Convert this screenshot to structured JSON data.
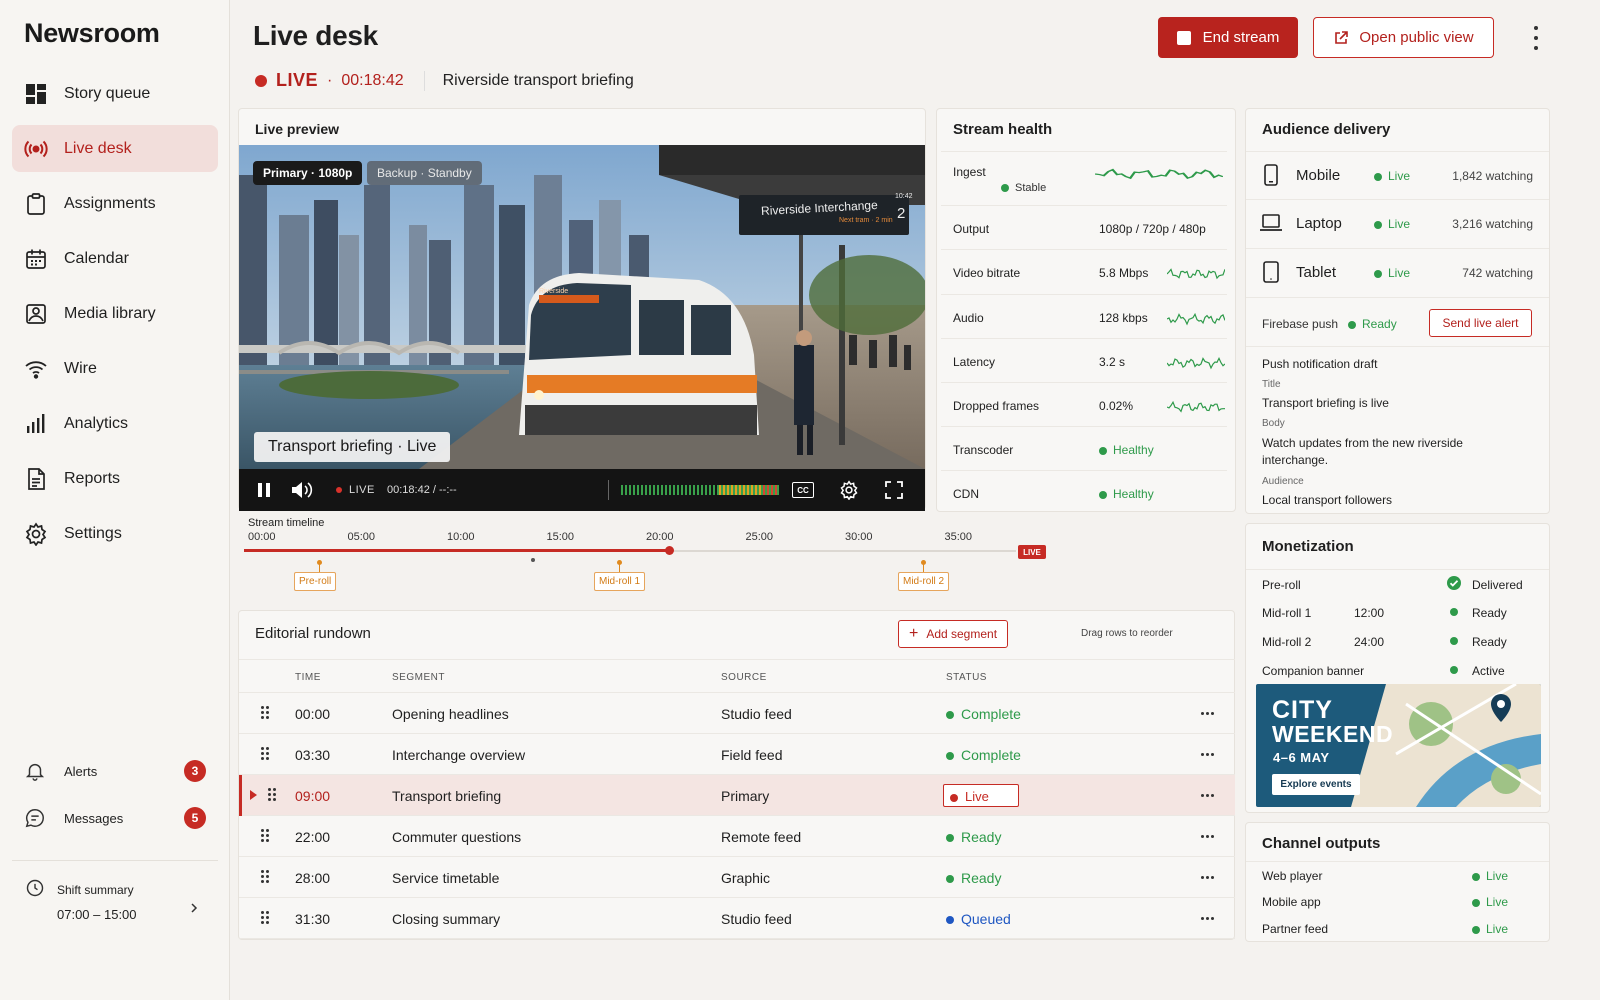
{
  "app": {
    "name": "Newsroom"
  },
  "sidebar": {
    "items": [
      {
        "label": "Story queue",
        "icon": "dashboard-grid-icon"
      },
      {
        "label": "Live desk",
        "icon": "broadcast-icon"
      },
      {
        "label": "Assignments",
        "icon": "clipboard-icon"
      },
      {
        "label": "Calendar",
        "icon": "calendar-icon"
      },
      {
        "label": "Media library",
        "icon": "image-icon"
      },
      {
        "label": "Wire",
        "icon": "wifi-icon"
      },
      {
        "label": "Analytics",
        "icon": "bar-chart-icon"
      },
      {
        "label": "Reports",
        "icon": "document-icon"
      },
      {
        "label": "Settings",
        "icon": "gear-icon"
      }
    ],
    "active": "Live desk",
    "alerts": {
      "label": "Alerts",
      "count": "3"
    },
    "messages": {
      "label": "Messages",
      "count": "5"
    },
    "shift": {
      "label": "Shift summary",
      "time": "07:00 – 15:00"
    }
  },
  "header": {
    "title": "Live desk",
    "status": "LIVE",
    "separator": "·",
    "elapsed": "00:18:42",
    "story": "Riverside transport briefing",
    "end_label": "End stream",
    "open_label": "Open public view"
  },
  "preview": {
    "title": "Live preview",
    "primary": "Primary · 1080p",
    "backup": "Backup · Standby",
    "lower_third": "Transport briefing · Live",
    "sign_title": "Riverside Interchange",
    "sign_sub": "Next tram · 2 min",
    "sign_num": "2",
    "sign_time": "10:42",
    "tram_dest": "Riverside",
    "controls": {
      "live": "LIVE",
      "time": "00:18:42 / --:--",
      "cc": "CC"
    }
  },
  "timeline": {
    "title": "Stream timeline",
    "ticks": [
      "00:00",
      "05:00",
      "10:00",
      "15:00",
      "20:00",
      "25:00",
      "30:00",
      "35:00"
    ],
    "live_badge": "LIVE",
    "progress": 0.5,
    "markers": [
      {
        "label": "Pre-roll"
      },
      {
        "label": "Mid-roll 1"
      },
      {
        "label": "Mid-roll 2"
      }
    ]
  },
  "health": {
    "title": "Stream health",
    "rows": [
      {
        "label": "Ingest",
        "value": "",
        "status": "Stable"
      },
      {
        "label": "Output",
        "value": "1080p / 720p / 480p"
      },
      {
        "label": "Video bitrate",
        "value": "5.8 Mbps"
      },
      {
        "label": "Audio",
        "value": "128 kbps"
      },
      {
        "label": "Latency",
        "value": "3.2 s"
      },
      {
        "label": "Dropped frames",
        "value": "0.02%"
      },
      {
        "label": "Transcoder",
        "value": "",
        "status": "Healthy"
      },
      {
        "label": "CDN",
        "value": "",
        "status": "Healthy"
      }
    ]
  },
  "audience": {
    "title": "Audience delivery",
    "devices": [
      {
        "name": "Mobile",
        "status": "Live",
        "count": "1,842 watching",
        "icon": "phone-icon"
      },
      {
        "name": "Laptop",
        "status": "Live",
        "count": "3,216 watching",
        "icon": "laptop-icon"
      },
      {
        "name": "Tablet",
        "status": "Live",
        "count": "742 watching",
        "icon": "tablet-icon"
      }
    ],
    "firebase": {
      "label": "Firebase push",
      "status": "Ready",
      "button": "Send live alert"
    },
    "draft": {
      "heading": "Push notification draft",
      "title_label": "Title",
      "title": "Transport briefing is live",
      "body_label": "Body",
      "body": "Watch updates from the new riverside interchange.",
      "audience_label": "Audience",
      "audience": "Local transport followers"
    }
  },
  "rundown": {
    "title": "Editorial rundown",
    "add_label": "Add segment",
    "hint": "Drag rows to reorder",
    "columns": [
      "TIME",
      "SEGMENT",
      "SOURCE",
      "STATUS"
    ],
    "rows": [
      {
        "time": "00:00",
        "segment": "Opening headlines",
        "source": "Studio feed",
        "status": "Complete"
      },
      {
        "time": "03:30",
        "segment": "Interchange overview",
        "source": "Field feed",
        "status": "Complete"
      },
      {
        "time": "09:00",
        "segment": "Transport briefing",
        "source": "Primary",
        "status": "Live"
      },
      {
        "time": "22:00",
        "segment": "Commuter questions",
        "source": "Remote feed",
        "status": "Ready"
      },
      {
        "time": "28:00",
        "segment": "Service timetable",
        "source": "Graphic",
        "status": "Ready"
      },
      {
        "time": "31:30",
        "segment": "Closing summary",
        "source": "Studio feed",
        "status": "Queued"
      }
    ]
  },
  "monetization": {
    "title": "Monetization",
    "rows": [
      {
        "label": "Pre-roll",
        "time": "",
        "status": "Delivered"
      },
      {
        "label": "Mid-roll 1",
        "time": "12:00",
        "status": "Ready"
      },
      {
        "label": "Mid-roll 2",
        "time": "24:00",
        "status": "Ready"
      },
      {
        "label": "Companion banner",
        "time": "",
        "status": "Active"
      }
    ],
    "banner": {
      "line1": "CITY",
      "line2": "WEEKEND",
      "dates": "4–6 MAY",
      "cta": "Explore events"
    }
  },
  "outputs": {
    "title": "Channel outputs",
    "rows": [
      {
        "label": "Web player",
        "status": "Live"
      },
      {
        "label": "Mobile app",
        "status": "Live"
      },
      {
        "label": "Partner feed",
        "status": "Live"
      }
    ]
  },
  "colors": {
    "accent": "#b8231e",
    "green": "#2e9a4a",
    "blue": "#1f57c2",
    "orange": "#e08a1e"
  }
}
